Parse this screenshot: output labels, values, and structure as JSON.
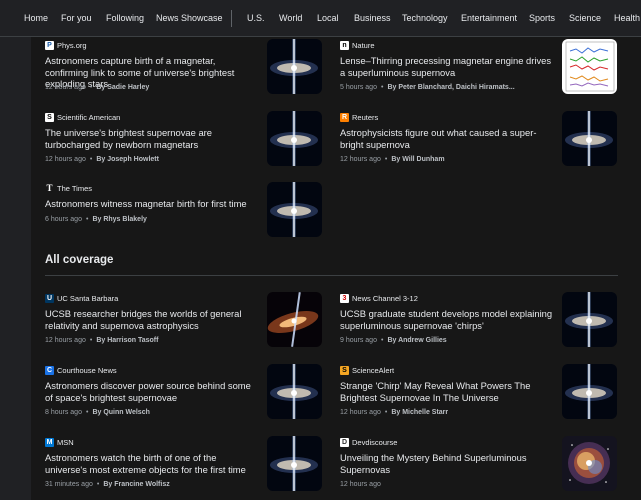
{
  "nav": [
    "Home",
    "For you",
    "Following",
    "News Showcase",
    "U.S.",
    "World",
    "Local",
    "Business",
    "Technology",
    "Entertainment",
    "Sports",
    "Science",
    "Health"
  ],
  "top_stories": [
    {
      "source": "Phys.org",
      "icon": "phys-org-icon",
      "headline": "Astronomers capture birth of a magnetar, confirming link to some of universe's brightest exploding stars",
      "time": "12 hours ago",
      "author": "By Sadie Harley",
      "thumb": "supernova-jet"
    },
    {
      "source": "Nature",
      "icon": "nature-icon",
      "headline": "Lense–Thirring precessing magnetar engine drives a superluminous supernova",
      "time": "5 hours ago",
      "author": "By Peter Blanchard, Daichi Hiramats...",
      "thumb": "light-curve-plot"
    },
    {
      "source": "Scientific American",
      "icon": "scientific-american-icon",
      "headline": "The universe's brightest supernovae are turbocharged by newborn magnetars",
      "time": "12 hours ago",
      "author": "By Joseph Howlett",
      "thumb": "supernova-jet"
    },
    {
      "source": "Reuters",
      "icon": "reuters-icon",
      "headline": "Astrophysicists figure out what caused a super-bright supernova",
      "time": "12 hours ago",
      "author": "By Will Dunham",
      "thumb": "supernova-jet"
    },
    {
      "source": "The Times",
      "icon": "the-times-icon",
      "headline": "Astronomers witness magnetar birth for first time",
      "time": "6 hours ago",
      "author": "By Rhys Blakely",
      "thumb": "supernova-jet"
    }
  ],
  "section_title": "All coverage",
  "coverage": [
    {
      "source": "UC Santa Barbara",
      "icon": "uc-santa-barbara-icon",
      "headline": "UCSB researcher bridges the worlds of general relativity and supernova astrophysics",
      "time": "12 hours ago",
      "author": "By Harrison Tasoff",
      "thumb": "tilted-jet"
    },
    {
      "source": "News Channel 3-12",
      "icon": "news-channel-icon",
      "headline": "UCSB graduate student develops model explaining superluminous supernovae 'chirps'",
      "time": "9 hours ago",
      "author": "By Andrew Gillies",
      "thumb": "supernova-jet"
    },
    {
      "source": "Courthouse News",
      "icon": "courthouse-news-icon",
      "headline": "Astronomers discover power source behind some of space's brightest supernovae",
      "time": "8 hours ago",
      "author": "By Quinn Welsch",
      "thumb": "supernova-jet"
    },
    {
      "source": "ScienceAlert",
      "icon": "sciencealert-icon",
      "headline": "Strange 'Chirp' May Reveal What Powers The Brightest Supernovae In The Universe",
      "time": "12 hours ago",
      "author": "By Michelle Starr",
      "thumb": "supernova-jet"
    },
    {
      "source": "MSN",
      "icon": "msn-icon",
      "headline": "Astronomers watch the birth of one of the universe's most extreme objects for the first time",
      "time": "31 minutes ago",
      "author": "By Francine Wolfisz",
      "thumb": "supernova-jet"
    },
    {
      "source": "Devdiscourse",
      "icon": "devdiscourse-icon",
      "headline": "Unveiling the Mystery Behind Superluminous Supernovas",
      "time": "12 hours ago",
      "author": "",
      "thumb": "nebula"
    }
  ],
  "colors": {
    "background": "#202124",
    "panel": "#171717",
    "text": "#e8eaed",
    "muted": "#9aa0a6",
    "divider": "#3c4043"
  }
}
